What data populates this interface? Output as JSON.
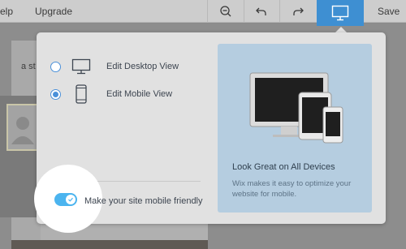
{
  "topbar": {
    "help_label": "elp",
    "upgrade_label": "Upgrade",
    "save_label": "Save",
    "zoom_icon": "zoom-out-icon",
    "undo_icon": "undo-icon",
    "redo_icon": "redo-icon",
    "device_icon": "desktop-monitor-icon",
    "device_button_color": "#3e8fd2"
  },
  "background_page": {
    "text_fragment": "a st"
  },
  "panel": {
    "options": [
      {
        "label": "Edit Desktop View",
        "selected": false,
        "icon": "desktop-icon"
      },
      {
        "label": "Edit Mobile View",
        "selected": true,
        "icon": "mobile-icon"
      }
    ],
    "toggle": {
      "label": "Make your site mobile friendly",
      "on": true,
      "color": "#4bb4ef"
    },
    "promo": {
      "title": "Look Great on All Devices",
      "description": "Wix makes it easy to optimize your website for mobile.",
      "background": "#b5cde0"
    }
  }
}
